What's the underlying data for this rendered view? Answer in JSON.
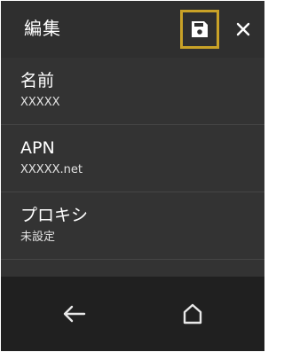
{
  "header": {
    "title": "編集",
    "save_icon": "save-icon",
    "close_icon": "close-icon"
  },
  "list": {
    "items": [
      {
        "label": "名前",
        "value": "XXXXX"
      },
      {
        "label": "APN",
        "value": "XXXXX.net"
      },
      {
        "label": "プロキシ",
        "value": "未設定"
      }
    ]
  },
  "navbar": {
    "back_icon": "back-arrow-icon",
    "home_icon": "home-icon"
  },
  "colors": {
    "highlight": "#c9a227",
    "background": "#333333",
    "navbar": "#202020"
  }
}
